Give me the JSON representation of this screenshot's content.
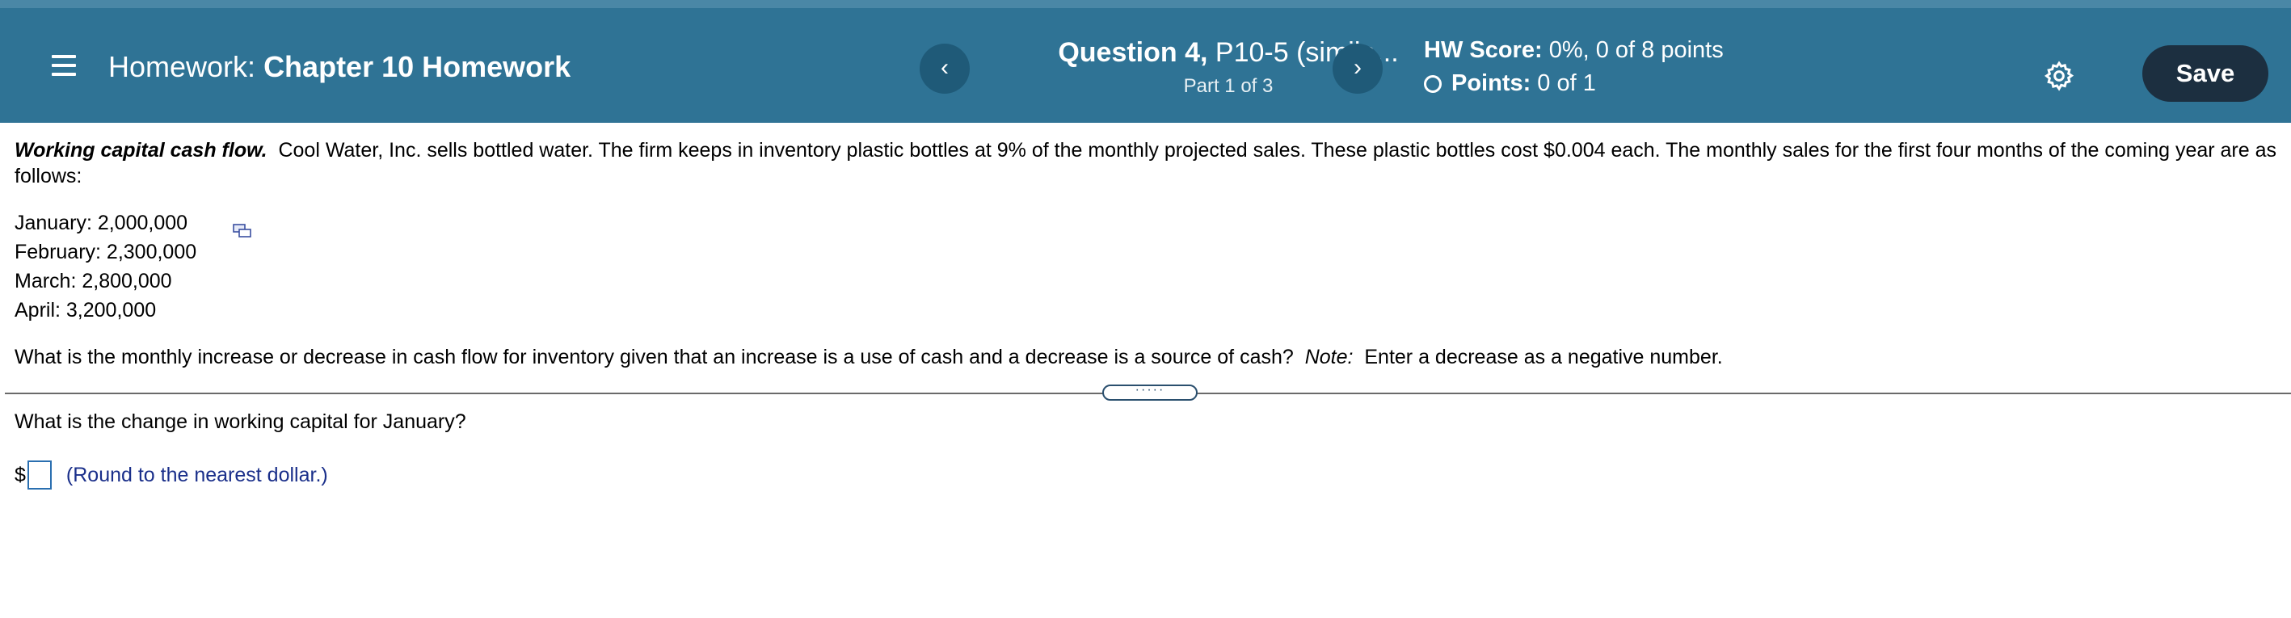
{
  "header": {
    "homework_prefix": "Homework:",
    "homework_name": "Chapter 10 Homework",
    "question_bold": "Question 4,",
    "question_rest": "P10-5 (simila...",
    "part": "Part 1 of 3",
    "hw_score_label": "HW Score:",
    "hw_score_value": "0%, 0 of 8 points",
    "points_label": "Points:",
    "points_value": "0 of 1",
    "save_label": "Save",
    "prev_glyph": "‹",
    "next_glyph": "›"
  },
  "problem": {
    "title": "Working capital cash flow.",
    "text": "Cool Water, Inc. sells bottled water.  The firm keeps in inventory plastic bottles at 9% of the monthly projected sales.  These plastic bottles cost $0.004 each.  The monthly sales for the first four months of the coming year are as follows:",
    "sales": [
      "January:  2,000,000",
      "February:  2,300,000",
      "March:  2,800,000",
      "April:  3,200,000"
    ],
    "question_main": "What is the monthly increase or decrease in cash flow for inventory given that an increase is a use of cash and a decrease is a source of cash?",
    "note_label": "Note:",
    "note_text": "Enter a decrease as a negative number.",
    "handle_dots": "·····"
  },
  "answer": {
    "sub_question": "What is the change in working capital for January?",
    "currency": "$",
    "value": "",
    "hint": "(Round to the nearest dollar.)"
  },
  "icons": {
    "menu": "hamburger-icon",
    "settings": "gear-icon",
    "copy": "copy-data-icon",
    "prev": "chevron-left-icon",
    "next": "chevron-right-icon"
  },
  "colors": {
    "header_bg": "#2f7395",
    "nav_button": "#1f5a78",
    "save_button": "#1c2f40",
    "hint_text": "#1a2f8a"
  }
}
